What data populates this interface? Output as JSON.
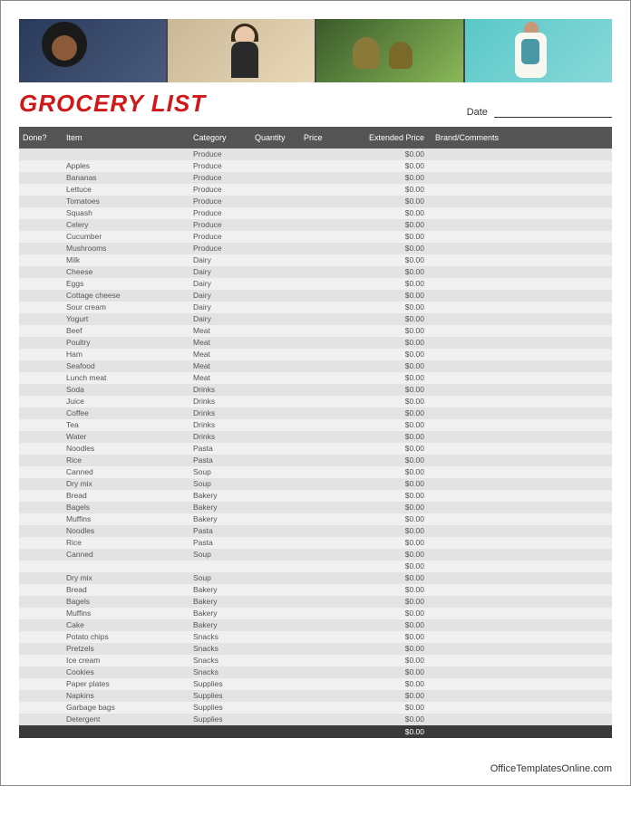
{
  "title": "GROCERY LIST",
  "date_label": "Date",
  "footer": "OfficeTemplatesOnline.com",
  "headers": {
    "done": "Done?",
    "item": "Item",
    "category": "Category",
    "quantity": "Quantity",
    "price": "Price",
    "ext": "Extended Price",
    "brand": "Brand/Comments"
  },
  "total_ext": "$0.00",
  "rows": [
    {
      "item": "",
      "category": "Produce",
      "ext": "$0.00"
    },
    {
      "item": "Apples",
      "category": "Produce",
      "ext": "$0.00"
    },
    {
      "item": "Bananas",
      "category": "Produce",
      "ext": "$0.00"
    },
    {
      "item": "Lettuce",
      "category": "Produce",
      "ext": "$0.00"
    },
    {
      "item": "Tomatoes",
      "category": "Produce",
      "ext": "$0.00"
    },
    {
      "item": "Squash",
      "category": "Produce",
      "ext": "$0.00"
    },
    {
      "item": "Celery",
      "category": "Produce",
      "ext": "$0.00"
    },
    {
      "item": "Cucumber",
      "category": "Produce",
      "ext": "$0.00"
    },
    {
      "item": "Mushrooms",
      "category": "Produce",
      "ext": "$0.00"
    },
    {
      "item": "Milk",
      "category": "Dairy",
      "ext": "$0.00"
    },
    {
      "item": "Cheese",
      "category": "Dairy",
      "ext": "$0.00"
    },
    {
      "item": "Eggs",
      "category": "Dairy",
      "ext": "$0.00"
    },
    {
      "item": "Cottage cheese",
      "category": "Dairy",
      "ext": "$0.00"
    },
    {
      "item": "Sour cream",
      "category": "Dairy",
      "ext": "$0.00"
    },
    {
      "item": "Yogurt",
      "category": "Dairy",
      "ext": "$0.00"
    },
    {
      "item": "Beef",
      "category": "Meat",
      "ext": "$0.00"
    },
    {
      "item": "Poultry",
      "category": "Meat",
      "ext": "$0.00"
    },
    {
      "item": "Ham",
      "category": "Meat",
      "ext": "$0.00"
    },
    {
      "item": "Seafood",
      "category": "Meat",
      "ext": "$0.00"
    },
    {
      "item": "Lunch meat",
      "category": "Meat",
      "ext": "$0.00"
    },
    {
      "item": "Soda",
      "category": "Drinks",
      "ext": "$0.00"
    },
    {
      "item": "Juice",
      "category": "Drinks",
      "ext": "$0.00"
    },
    {
      "item": "Coffee",
      "category": "Drinks",
      "ext": "$0.00"
    },
    {
      "item": "Tea",
      "category": "Drinks",
      "ext": "$0.00"
    },
    {
      "item": "Water",
      "category": "Drinks",
      "ext": "$0.00"
    },
    {
      "item": "Noodles",
      "category": "Pasta",
      "ext": "$0.00"
    },
    {
      "item": "Rice",
      "category": "Pasta",
      "ext": "$0.00"
    },
    {
      "item": "Canned",
      "category": "Soup",
      "ext": "$0.00"
    },
    {
      "item": "Dry mix",
      "category": "Soup",
      "ext": "$0.00"
    },
    {
      "item": "Bread",
      "category": "Bakery",
      "ext": "$0.00"
    },
    {
      "item": "Bagels",
      "category": "Bakery",
      "ext": "$0.00"
    },
    {
      "item": "Muffins",
      "category": "Bakery",
      "ext": "$0.00"
    },
    {
      "item": "Noodles",
      "category": "Pasta",
      "ext": "$0.00"
    },
    {
      "item": "Rice",
      "category": "Pasta",
      "ext": "$0.00"
    },
    {
      "item": "Canned",
      "category": "Soup",
      "ext": "$0.00"
    },
    {
      "item": "",
      "category": "",
      "ext": "$0.00"
    },
    {
      "item": "Dry mix",
      "category": "Soup",
      "ext": "$0.00"
    },
    {
      "item": "Bread",
      "category": "Bakery",
      "ext": "$0.00"
    },
    {
      "item": "Bagels",
      "category": "Bakery",
      "ext": "$0.00"
    },
    {
      "item": "Muffins",
      "category": "Bakery",
      "ext": "$0.00"
    },
    {
      "item": "Cake",
      "category": "Bakery",
      "ext": "$0.00"
    },
    {
      "item": "Potato chips",
      "category": "Snacks",
      "ext": "$0.00"
    },
    {
      "item": "Pretzels",
      "category": "Snacks",
      "ext": "$0.00"
    },
    {
      "item": "Ice cream",
      "category": "Snacks",
      "ext": "$0.00"
    },
    {
      "item": "Cookies",
      "category": "Snacks",
      "ext": "$0.00"
    },
    {
      "item": "Paper plates",
      "category": "Supplies",
      "ext": "$0.00"
    },
    {
      "item": "Napkins",
      "category": "Supplies",
      "ext": "$0.00"
    },
    {
      "item": "Garbage bags",
      "category": "Supplies",
      "ext": "$0.00"
    },
    {
      "item": "Detergent",
      "category": "Supplies",
      "ext": "$0.00"
    }
  ]
}
